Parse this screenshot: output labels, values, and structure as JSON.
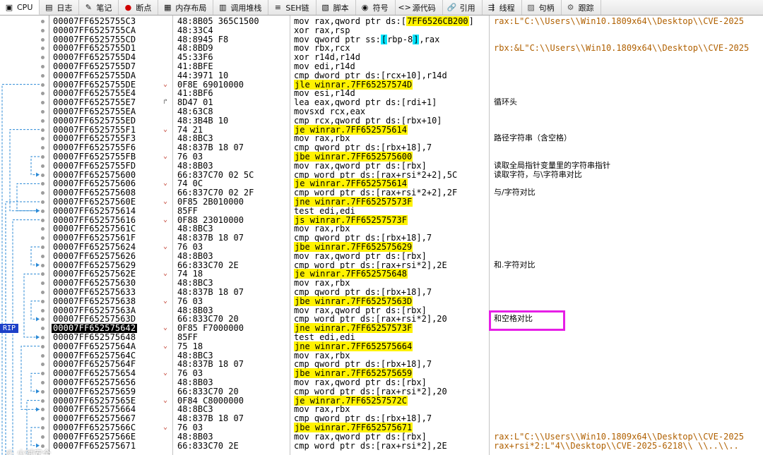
{
  "tabs": [
    {
      "label": "CPU",
      "icon": "cpu-icon",
      "glyph": "▣",
      "active": true
    },
    {
      "label": "日志",
      "icon": "log-icon",
      "glyph": "▤",
      "active": false
    },
    {
      "label": "笔记",
      "icon": "notes-icon",
      "glyph": "✎",
      "active": false
    },
    {
      "label": "断点",
      "icon": "breakpoint-icon",
      "glyph": "●",
      "active": false
    },
    {
      "label": "内存布局",
      "icon": "memory-map-icon",
      "glyph": "▦",
      "active": false
    },
    {
      "label": "调用堆栈",
      "icon": "call-stack-icon",
      "glyph": "▥",
      "active": false
    },
    {
      "label": "SEH链",
      "icon": "seh-chain-icon",
      "glyph": "≡",
      "active": false
    },
    {
      "label": "脚本",
      "icon": "script-icon",
      "glyph": "▧",
      "active": false
    },
    {
      "label": "符号",
      "icon": "symbols-icon",
      "glyph": "◉",
      "active": false
    },
    {
      "label": "源代码",
      "icon": "source-code-icon",
      "glyph": "<>",
      "active": false
    },
    {
      "label": "引用",
      "icon": "references-icon",
      "glyph": "🔗",
      "active": false
    },
    {
      "label": "线程",
      "icon": "threads-icon",
      "glyph": "⇶",
      "active": false
    },
    {
      "label": "句柄",
      "icon": "handles-icon",
      "glyph": "▨",
      "active": false
    },
    {
      "label": "跟踪",
      "icon": "trace-icon",
      "glyph": "⚙",
      "active": false
    }
  ],
  "accent": {
    "rip_bg": "#1c40c8",
    "highlight": "#fff200",
    "frame": "#e61ee6",
    "string_color": "#b06000"
  },
  "rip_label": "RIP",
  "watermark": "© 火绒安全",
  "rows": [
    {
      "addr": "00007FF6525755C3",
      "bytes": "48:8B05 365C1500",
      "instr": [
        {
          "t": "mov rax,qword ptr ds:["
        },
        {
          "t": "7FF6526CB200",
          "c": "hl"
        },
        {
          "t": "]"
        }
      ],
      "comment": "rax:L\"C:\\\\Users\\\\Win10.1809x64\\\\Desktop\\\\CVE-2025",
      "cstr": true
    },
    {
      "addr": "00007FF6525755CA",
      "bytes": "48:33C4",
      "instr": [
        {
          "t": "xor rax,rsp"
        }
      ]
    },
    {
      "addr": "00007FF6525755CD",
      "bytes": "48:8945 F8",
      "instr": [
        {
          "t": "mov qword ptr ss:"
        },
        {
          "t": "[",
          "c": "hl-cyan"
        },
        {
          "t": "rbp-8"
        },
        {
          "t": "]",
          "c": "hl-cyan"
        },
        {
          "t": ",rax"
        }
      ]
    },
    {
      "addr": "00007FF6525755D1",
      "bytes": "48:8BD9",
      "instr": [
        {
          "t": "mov rbx,rcx"
        }
      ],
      "comment": "rbx:&L\"C:\\\\Users\\\\Win10.1809x64\\\\Desktop\\\\CVE-2025",
      "cstr": true
    },
    {
      "addr": "00007FF6525755D4",
      "bytes": "45:33F6",
      "instr": [
        {
          "t": "xor r14d,r14d"
        }
      ]
    },
    {
      "addr": "00007FF6525755D7",
      "bytes": "41:8BFE",
      "instr": [
        {
          "t": "mov edi,r14d"
        }
      ]
    },
    {
      "addr": "00007FF6525755DA",
      "bytes": "44:3971 10",
      "instr": [
        {
          "t": "cmp dword ptr ds:[rcx+10],r14d"
        }
      ]
    },
    {
      "addr": "00007FF6525755DE",
      "bytes": "0F8E 69010000",
      "arrow": "down",
      "instr": [
        {
          "t": "jle winrar.7FF65257574D",
          "c": "hl"
        }
      ]
    },
    {
      "addr": "00007FF6525755E4",
      "bytes": "41:8BF6",
      "instr": [
        {
          "t": "mov esi,r14d"
        }
      ]
    },
    {
      "addr": "00007FF6525755E7",
      "bytes": "8D47 01",
      "arrow": "up",
      "instr": [
        {
          "t": "lea eax,qword ptr ds:[rdi+1]"
        }
      ],
      "comment": "循环头"
    },
    {
      "addr": "00007FF6525755EA",
      "bytes": "48:63C8",
      "instr": [
        {
          "t": "movsxd rcx,eax"
        }
      ]
    },
    {
      "addr": "00007FF6525755ED",
      "bytes": "48:3B4B 10",
      "instr": [
        {
          "t": "cmp rcx,qword ptr ds:[rbx+10]"
        }
      ]
    },
    {
      "addr": "00007FF6525755F1",
      "bytes": "74 21",
      "arrow": "down",
      "instr": [
        {
          "t": "je winrar.7FF652575614",
          "c": "hl"
        }
      ]
    },
    {
      "addr": "00007FF6525755F3",
      "bytes": "48:8BC3",
      "instr": [
        {
          "t": "mov rax,rbx"
        }
      ],
      "comment": "路径字符串（含空格）"
    },
    {
      "addr": "00007FF6525755F6",
      "bytes": "48:837B 18 07",
      "instr": [
        {
          "t": "cmp qword ptr ds:[rbx+18],7"
        }
      ]
    },
    {
      "addr": "00007FF6525755FB",
      "bytes": "76 03",
      "arrow": "down",
      "instr": [
        {
          "t": "jbe winrar.7FF652575600",
          "c": "hl"
        }
      ]
    },
    {
      "addr": "00007FF6525755FD",
      "bytes": "48:8B03",
      "instr": [
        {
          "t": "mov rax,qword ptr ds:[rbx]"
        }
      ],
      "comment": "读取全局指针变量里的字符串指针"
    },
    {
      "addr": "00007FF652575600",
      "bytes": "66:837C70 02 5C",
      "instr": [
        {
          "t": "cmp word ptr ds:[rax+rsi*2+2],5C"
        }
      ],
      "comment": "读取字符，与\\字符串对比"
    },
    {
      "addr": "00007FF652575606",
      "bytes": "74 0C",
      "arrow": "down",
      "instr": [
        {
          "t": "je winrar.7FF652575614",
          "c": "hl"
        }
      ]
    },
    {
      "addr": "00007FF652575608",
      "bytes": "66:837C70 02 2F",
      "instr": [
        {
          "t": "cmp word ptr ds:[rax+rsi*2+2],2F"
        }
      ],
      "comment": "与/字符对比"
    },
    {
      "addr": "00007FF65257560E",
      "bytes": "0F85 2B010000",
      "arrow": "down",
      "instr": [
        {
          "t": "jne winrar.7FF65257573F",
          "c": "hl"
        }
      ]
    },
    {
      "addr": "00007FF652575614",
      "bytes": "85FF",
      "instr": [
        {
          "t": "test edi,edi"
        }
      ]
    },
    {
      "addr": "00007FF652575616",
      "bytes": "0F88 23010000",
      "arrow": "down",
      "instr": [
        {
          "t": "js winrar.7FF65257573F",
          "c": "hl"
        }
      ]
    },
    {
      "addr": "00007FF65257561C",
      "bytes": "48:8BC3",
      "instr": [
        {
          "t": "mov rax,rbx"
        }
      ]
    },
    {
      "addr": "00007FF65257561F",
      "bytes": "48:837B 18 07",
      "instr": [
        {
          "t": "cmp qword ptr ds:[rbx+18],7"
        }
      ]
    },
    {
      "addr": "00007FF652575624",
      "bytes": "76 03",
      "arrow": "down",
      "instr": [
        {
          "t": "jbe winrar.7FF652575629",
          "c": "hl"
        }
      ]
    },
    {
      "addr": "00007FF652575626",
      "bytes": "48:8B03",
      "instr": [
        {
          "t": "mov rax,qword ptr ds:[rbx]"
        }
      ]
    },
    {
      "addr": "00007FF652575629",
      "bytes": "66:833C70 2E",
      "instr": [
        {
          "t": "cmp word ptr ds:[rax+rsi*2],2E"
        }
      ],
      "comment": "和.字符对比"
    },
    {
      "addr": "00007FF65257562E",
      "bytes": "74 18",
      "arrow": "down",
      "instr": [
        {
          "t": "je winrar.7FF652575648",
          "c": "hl"
        }
      ]
    },
    {
      "addr": "00007FF652575630",
      "bytes": "48:8BC3",
      "instr": [
        {
          "t": "mov rax,rbx"
        }
      ]
    },
    {
      "addr": "00007FF652575633",
      "bytes": "48:837B 18 07",
      "instr": [
        {
          "t": "cmp qword ptr ds:[rbx+18],7"
        }
      ]
    },
    {
      "addr": "00007FF652575638",
      "bytes": "76 03",
      "arrow": "down",
      "instr": [
        {
          "t": "jbe winrar.7FF65257563D",
          "c": "hl"
        }
      ]
    },
    {
      "addr": "00007FF65257563A",
      "bytes": "48:8B03",
      "instr": [
        {
          "t": "mov rax,qword ptr ds:[rbx]"
        }
      ]
    },
    {
      "addr": "00007FF65257563D",
      "bytes": "66:833C70 20",
      "instr": [
        {
          "t": "cmp word ptr ds:[rax+rsi*2],20"
        }
      ],
      "comment": "和空格对比"
    },
    {
      "addr": "00007FF652575642",
      "bytes": "0F85 F7000000",
      "arrow": "down",
      "current": true,
      "instr": [
        {
          "t": "jne winrar.7FF65257573F",
          "c": "hl"
        }
      ]
    },
    {
      "addr": "00007FF652575648",
      "bytes": "85FF",
      "instr": [
        {
          "t": "test edi,edi"
        }
      ]
    },
    {
      "addr": "00007FF65257564A",
      "bytes": "75 18",
      "arrow": "down",
      "instr": [
        {
          "t": "jne winrar.7FF652575664",
          "c": "hl"
        }
      ]
    },
    {
      "addr": "00007FF65257564C",
      "bytes": "48:8BC3",
      "instr": [
        {
          "t": "mov rax,rbx"
        }
      ]
    },
    {
      "addr": "00007FF65257564F",
      "bytes": "48:837B 18 07",
      "instr": [
        {
          "t": "cmp qword ptr ds:[rbx+18],7"
        }
      ]
    },
    {
      "addr": "00007FF652575654",
      "bytes": "76 03",
      "arrow": "down",
      "instr": [
        {
          "t": "jbe winrar.7FF652575659",
          "c": "hl"
        }
      ]
    },
    {
      "addr": "00007FF652575656",
      "bytes": "48:8B03",
      "instr": [
        {
          "t": "mov rax,qword ptr ds:[rbx]"
        }
      ]
    },
    {
      "addr": "00007FF652575659",
      "bytes": "66:833C70 20",
      "instr": [
        {
          "t": "cmp word ptr ds:[rax+rsi*2],20"
        }
      ]
    },
    {
      "addr": "00007FF65257565E",
      "bytes": "0F84 C8000000",
      "arrow": "down",
      "instr": [
        {
          "t": "je winrar.7FF65257572C",
          "c": "hl"
        }
      ]
    },
    {
      "addr": "00007FF652575664",
      "bytes": "48:8BC3",
      "instr": [
        {
          "t": "mov rax,rbx"
        }
      ]
    },
    {
      "addr": "00007FF652575667",
      "bytes": "48:837B 18 07",
      "instr": [
        {
          "t": "cmp qword ptr ds:[rbx+18],7"
        }
      ]
    },
    {
      "addr": "00007FF65257566C",
      "bytes": "76 03",
      "arrow": "down",
      "instr": [
        {
          "t": "jbe winrar.7FF652575671",
          "c": "hl"
        }
      ]
    },
    {
      "addr": "00007FF65257566E",
      "bytes": "48:8B03",
      "instr": [
        {
          "t": "mov rax,qword ptr ds:[rbx]"
        }
      ],
      "comment": "rax:L\"C:\\\\Users\\\\Win10.1809x64\\\\Desktop\\\\CVE-2025",
      "cstr": true
    },
    {
      "addr": "00007FF652575671",
      "bytes": "66:833C70 2E",
      "instr": [
        {
          "t": "cmp word ptr ds:[rax+rsi*2],2E"
        }
      ],
      "comment": "rax+rsi*2:L\"4\\\\Desktop\\\\CVE-2025-6218\\\\ \\\\..\\\\..",
      "cstr": true
    }
  ]
}
